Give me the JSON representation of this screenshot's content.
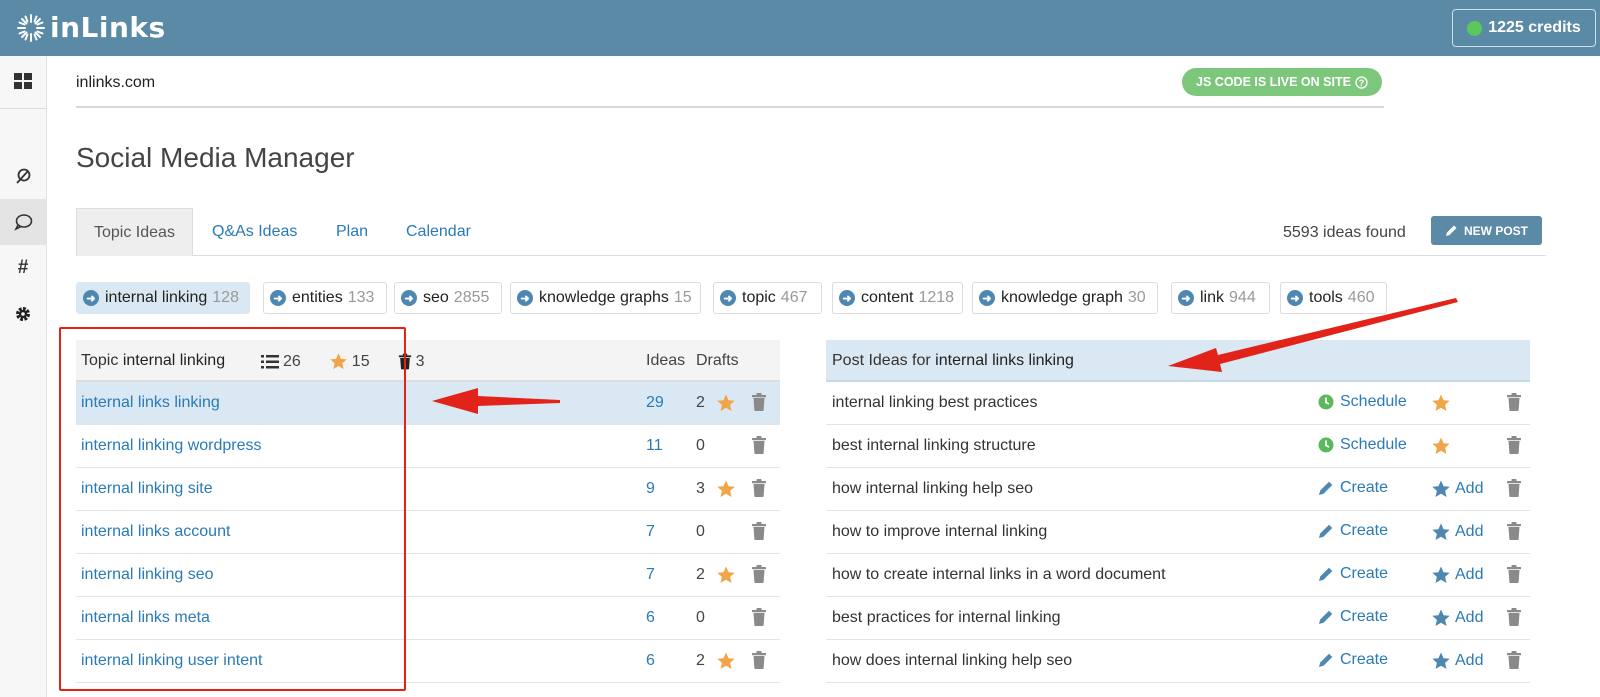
{
  "app": {
    "brand": "inLinks",
    "credits": "1225 credits"
  },
  "domain": {
    "name": "inlinks.com",
    "js_status": "JS CODE IS LIVE ON SITE"
  },
  "page": {
    "title": "Social Media Manager"
  },
  "tabs": [
    {
      "label": "Topic Ideas"
    },
    {
      "label": "Q&As Ideas"
    },
    {
      "label": "Plan"
    },
    {
      "label": "Calendar"
    }
  ],
  "ideas_found": "5593 ideas found",
  "new_post_label": "NEW POST",
  "chips": [
    {
      "label": "internal linking",
      "count": "128"
    },
    {
      "label": "entities",
      "count": "133"
    },
    {
      "label": "seo",
      "count": "2855"
    },
    {
      "label": "knowledge graphs",
      "count": "15"
    },
    {
      "label": "topic",
      "count": "467"
    },
    {
      "label": "content",
      "count": "1218"
    },
    {
      "label": "knowledge graph",
      "count": "30"
    },
    {
      "label": "link",
      "count": "944"
    },
    {
      "label": "tools",
      "count": "460"
    }
  ],
  "topics_panel": {
    "header_prefix": "Topic",
    "header_topic": "internal linking",
    "stat_list": "26",
    "stat_star": "15",
    "stat_trash": "3",
    "col_ideas": "Ideas",
    "col_drafts": "Drafts",
    "rows": [
      {
        "topic": "internal links linking",
        "ideas": "29",
        "drafts": "2",
        "starred": true
      },
      {
        "topic": "internal linking wordpress",
        "ideas": "11",
        "drafts": "0",
        "starred": false
      },
      {
        "topic": "internal linking site",
        "ideas": "9",
        "drafts": "3",
        "starred": true
      },
      {
        "topic": "internal links account",
        "ideas": "7",
        "drafts": "0",
        "starred": false
      },
      {
        "topic": "internal linking seo",
        "ideas": "7",
        "drafts": "2",
        "starred": true
      },
      {
        "topic": "internal links meta",
        "ideas": "6",
        "drafts": "0",
        "starred": false
      },
      {
        "topic": "internal linking user intent",
        "ideas": "6",
        "drafts": "2",
        "starred": true
      }
    ]
  },
  "ideas_panel": {
    "header_prefix": "Post Ideas for",
    "header_topic": "internal links linking",
    "rows": [
      {
        "idea": "internal linking best practices",
        "action": "Schedule",
        "fav": ""
      },
      {
        "idea": "best internal linking structure",
        "action": "Schedule",
        "fav": ""
      },
      {
        "idea": "how internal linking help seo",
        "action": "Create",
        "fav": "Add"
      },
      {
        "idea": "how to improve internal linking",
        "action": "Create",
        "fav": "Add"
      },
      {
        "idea": "how to create internal links in a word document",
        "action": "Create",
        "fav": "Add"
      },
      {
        "idea": "best practices for internal linking",
        "action": "Create",
        "fav": "Add"
      },
      {
        "idea": "how does internal linking help seo",
        "action": "Create",
        "fav": "Add"
      }
    ]
  },
  "colors": {
    "header": "#5a8aa6",
    "link": "#2a7ab8",
    "star": "#f0a54a",
    "schedule": "#5cb85c",
    "annotation": "#e2231a"
  }
}
